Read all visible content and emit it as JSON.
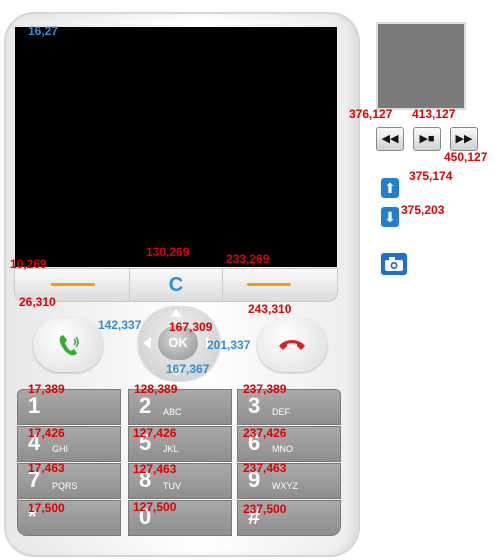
{
  "coords": {
    "screen_tl": "16,27",
    "soft_left": "10,269",
    "soft_center": "130,269",
    "soft_right": "233,269",
    "call_left": "26,310",
    "call_right": "243,310",
    "dpad_top": "167,309",
    "dpad_left": "142,337",
    "dpad_right": "201,337",
    "dpad_bottom": "167,367",
    "key1": "17,389",
    "key2": "128,389",
    "key3": "237,389",
    "key4": "17,426",
    "key5": "127,426",
    "key6": "237,426",
    "key7": "17,463",
    "key8": "127,463",
    "key9": "237,463",
    "keystar": "17,500",
    "key0": "127,500",
    "keyhash": "237,500",
    "media_rew": "376,127",
    "media_play": "413,127",
    "media_ffw": "450,127",
    "scroll_up": "375,174",
    "scroll_down": "375,203"
  },
  "softkeys": {
    "center_label": "C"
  },
  "dpad": {
    "ok_label": "OK"
  },
  "keys": [
    {
      "num": "1",
      "sub": ""
    },
    {
      "num": "2",
      "sub": "ABC"
    },
    {
      "num": "3",
      "sub": "DEF"
    },
    {
      "num": "4",
      "sub": "GHI"
    },
    {
      "num": "5",
      "sub": "JKL"
    },
    {
      "num": "6",
      "sub": "MNO"
    },
    {
      "num": "7",
      "sub": "PQRS"
    },
    {
      "num": "8",
      "sub": "TUV"
    },
    {
      "num": "9",
      "sub": "WXYZ"
    },
    {
      "num": "*",
      "sub": ""
    },
    {
      "num": "0",
      "sub": ""
    },
    {
      "num": "#",
      "sub": ""
    }
  ],
  "media": {
    "rew_glyph": "◀◀",
    "play_glyph": "▶■",
    "ffw_glyph": "▶▶"
  },
  "scroll": {
    "up_glyph": "⬆",
    "down_glyph": "⬇"
  },
  "icons": {
    "call": "phone-call-icon",
    "end": "phone-end-icon",
    "camera": "camera-icon"
  },
  "colors": {
    "label_red": "#e00000",
    "label_blue": "#2e8fd8",
    "softkey_dash": "#f0a000"
  }
}
